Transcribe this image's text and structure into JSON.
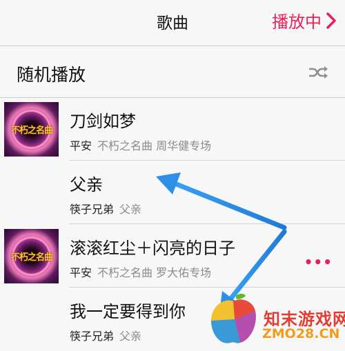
{
  "nav": {
    "title": "歌曲",
    "now_playing": "播放中"
  },
  "shuffle": {
    "label": "随机播放",
    "icon": "shuffle-icon"
  },
  "songs": [
    {
      "title": "刀剑如梦",
      "artist": "平安",
      "album": "不朽之名曲 周华健专场",
      "has_art": true,
      "art_text": "不朽之名曲"
    },
    {
      "title": "父亲",
      "artist": "筷子兄弟",
      "album": "父亲",
      "has_art": false
    },
    {
      "title": "滚滚红尘＋闪亮的日子",
      "artist": "平安",
      "album": "不朽之名曲 罗大佑专场",
      "has_art": true,
      "art_text": "不朽之名曲",
      "more": "•••"
    },
    {
      "title": "我一定要得到你",
      "artist": "筷子兄弟",
      "album": "父亲",
      "has_art": false
    }
  ],
  "watermark": {
    "cn": "知末游戏网",
    "en": "ZMO28.CN"
  },
  "colors": {
    "accent": "#e8205a",
    "arrow": "#2d8fe8",
    "background": "#f7f7f7"
  }
}
